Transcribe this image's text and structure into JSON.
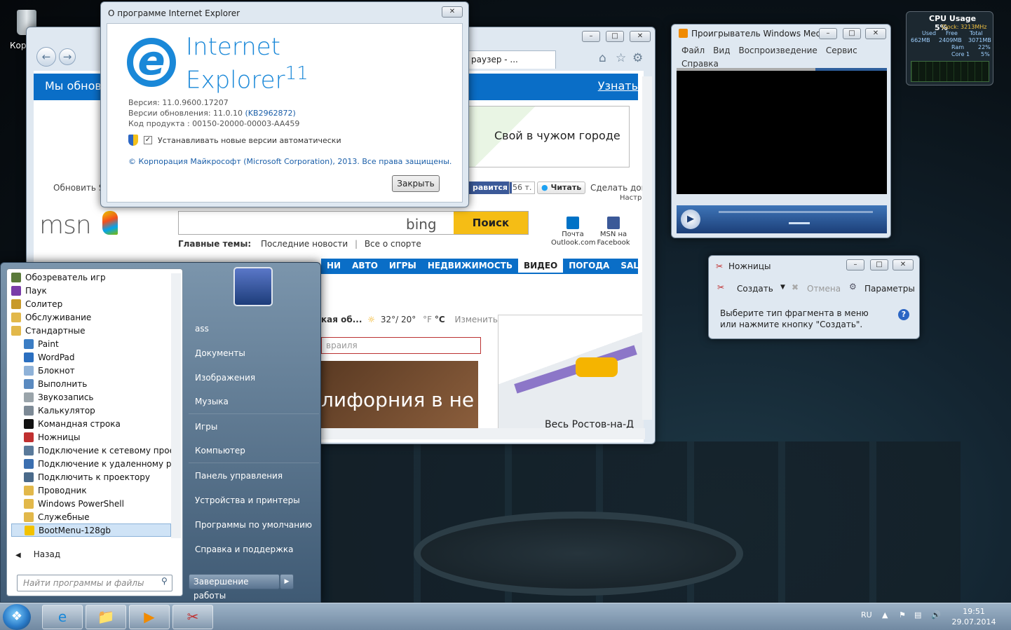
{
  "desktop": {
    "recycle_label": "Кор"
  },
  "ie": {
    "tab_title": "раузер - ...",
    "banner_text": "Мы обнов...",
    "banner_link": "Узнать",
    "ad_text": "Свой в чужом городе",
    "refresh_text": "Обновить Si",
    "fb_like": "равится",
    "fb_count": "56 т.",
    "twitter": "Читать",
    "home_text": "Сделать дом",
    "settings_text": "Настр",
    "msn_logo": "msn",
    "search_btn": "Поиск",
    "bing": "bing",
    "topics_label": "Главные темы:",
    "topic_1": "Последние новости",
    "topic_sep": "|",
    "topic_2": "Все о спорте",
    "outlook_label": "Почта Outlook.com",
    "facebook_label": "MSN на Facebook",
    "nav": [
      "НИ",
      "АВТО",
      "ИГРЫ",
      "НЕДВИЖИМОСТЬ",
      "ВИДЕО",
      "ПОГОДА",
      "SALE"
    ],
    "weather_city": "кая об...",
    "weather_temp": "32°/ 20°",
    "weather_f": "°F",
    "weather_c": "°C",
    "weather_change": "Изменить",
    "input_placeholder": "враиля",
    "news_title": "лифорния в не",
    "map_caption": "Весь Ростов-на-Д"
  },
  "about": {
    "title": "О программе Internet Explorer",
    "product_line1": "Internet",
    "product_line2": "Explorer",
    "product_version_mark": "11",
    "version": "Версия: 11.0.9600.17207",
    "update_version": "Версии обновления: 11.0.10",
    "kb": "(KB2962872)",
    "product_code": "Код продукта : 00150-20000-00003-AA459",
    "auto_update": "Устанавливать новые версии автоматически",
    "copyright": "© Корпорация Майкрософт (Microsoft Corporation), 2013. Все права защищены.",
    "close": "Закрыть"
  },
  "wmp": {
    "title": "Проигрыватель Windows Media",
    "menu": [
      "Файл",
      "Вид",
      "Воспроизведение",
      "Сервис",
      "Справка"
    ]
  },
  "snip": {
    "title": "Ножницы",
    "create": "Создать",
    "cancel": "Отмена",
    "options": "Параметры",
    "message": "Выберите тип фрагмента в меню или нажмите кнопку \"Создать\"."
  },
  "cpu": {
    "title": "CPU Usage",
    "usage": "5%",
    "clock": "Clock: 3213MHz",
    "used_label": "Used",
    "free_label": "Free",
    "total_label": "Total",
    "used": "662MB",
    "free": "2409MB",
    "total": "3071MB",
    "ram_label": "Ram",
    "ram": "22%",
    "core_label": "Core 1",
    "core": "5%"
  },
  "start": {
    "programs": [
      {
        "label": "Обозреватель игр",
        "color": "#5a7a3a"
      },
      {
        "label": "Паук",
        "color": "#7a3ca8"
      },
      {
        "label": "Солитер",
        "color": "#c89a2a"
      },
      {
        "label": "Обслуживание",
        "color": "#e2b84a"
      },
      {
        "label": "Стандартные",
        "color": "#e2b84a"
      },
      {
        "label": "Paint",
        "color": "#3b7dc4"
      },
      {
        "label": "WordPad",
        "color": "#2b6fc0"
      },
      {
        "label": "Блокнот",
        "color": "#8fb2d8"
      },
      {
        "label": "Выполнить",
        "color": "#5a8ac0"
      },
      {
        "label": "Звукозапись",
        "color": "#9aa4aa"
      },
      {
        "label": "Калькулятор",
        "color": "#7d8a96"
      },
      {
        "label": "Командная строка",
        "color": "#111111"
      },
      {
        "label": "Ножницы",
        "color": "#c03030"
      },
      {
        "label": "Подключение к сетевому проекто",
        "color": "#5a7a9a"
      },
      {
        "label": "Подключение к удаленному рабо",
        "color": "#3b6fb0"
      },
      {
        "label": "Подключить к проектору",
        "color": "#4a6a8a"
      },
      {
        "label": "Проводник",
        "color": "#e2b84a"
      },
      {
        "label": "Windows PowerShell",
        "color": "#e2b84a"
      },
      {
        "label": "Служебные",
        "color": "#e2b84a"
      },
      {
        "label": "BootMenu-128gb",
        "color": "#f2c200"
      }
    ],
    "back": "Назад",
    "search_placeholder": "Найти программы и файлы",
    "right": [
      "ass",
      "Документы",
      "Изображения",
      "Музыка",
      "Игры",
      "Компьютер",
      "Панель управления",
      "Устройства и принтеры",
      "Программы по умолчанию",
      "Справка и поддержка"
    ],
    "shutdown": "Завершение работы"
  },
  "taskbar": {
    "lang": "RU",
    "time": "19:51",
    "date": "29.07.2014"
  }
}
